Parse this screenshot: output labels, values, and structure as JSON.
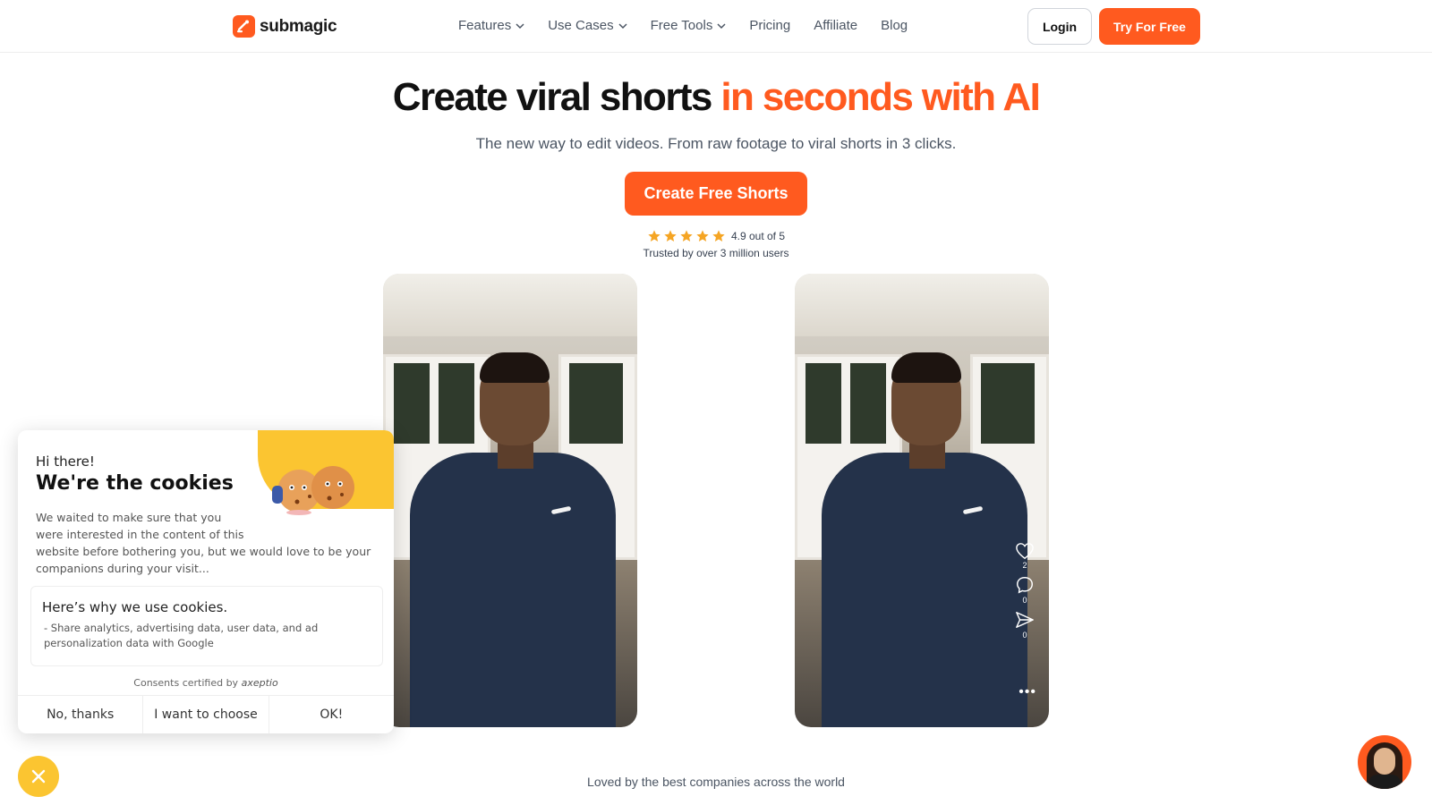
{
  "brand": {
    "name": "submagic",
    "accent": "#ff5a1f"
  },
  "nav": {
    "items": [
      {
        "label": "Features",
        "dropdown": true
      },
      {
        "label": "Use Cases",
        "dropdown": true
      },
      {
        "label": "Free Tools",
        "dropdown": true
      },
      {
        "label": "Pricing",
        "dropdown": false
      },
      {
        "label": "Affiliate",
        "dropdown": false
      },
      {
        "label": "Blog",
        "dropdown": false
      }
    ],
    "login_label": "Login",
    "try_label": "Try For Free"
  },
  "hero": {
    "title_main": "Create viral shorts",
    "title_accent": "in seconds with AI",
    "subtitle": "The new way to edit videos. From raw footage to viral shorts in 3 clicks.",
    "cta_label": "Create Free Shorts",
    "rating_text": "4.9 out of 5",
    "rating_value": 4.9,
    "rating_max": 5,
    "trust_text": "Trusted by over 3 million users"
  },
  "video_right": {
    "likes": "2",
    "comments": "0",
    "shares": "0"
  },
  "loved_text": "Loved by the best companies across the world",
  "cookie": {
    "greeting": "Hi there!",
    "title": "We're the cookies",
    "description_a": "We waited to make sure that you were interested in the content of this",
    "description_b": "website before bothering you, but we would love to be your companions during your visit...",
    "why_title": "Here’s why we use cookies.",
    "bullet": "- Share analytics, advertising data, user data, and ad personalization data with Google",
    "certified_prefix": "Consents certified by",
    "certified_brand": "axeptio",
    "buttons": {
      "decline": "No, thanks",
      "choose": "I want to choose",
      "accept": "OK!"
    },
    "accent": "#fbc531"
  }
}
